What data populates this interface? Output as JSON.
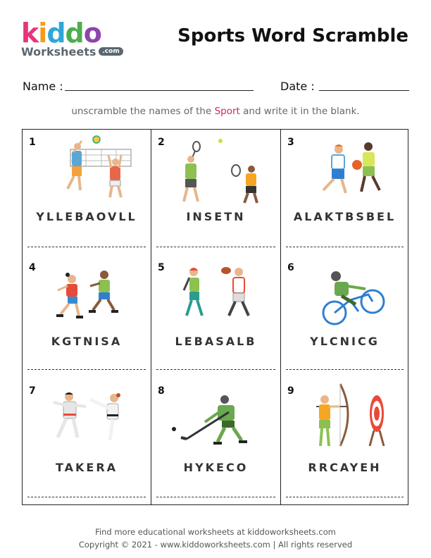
{
  "logo": {
    "letters": [
      {
        "ch": "k",
        "color": "#e8347a"
      },
      {
        "ch": "i",
        "color": "#f39c1b"
      },
      {
        "ch": "d",
        "color": "#2ea7d8"
      },
      {
        "ch": "d",
        "color": "#4cae4f"
      },
      {
        "ch": "o",
        "color": "#8e44ad"
      }
    ],
    "sub": "Worksheets",
    "com": ".com"
  },
  "title": "Sports Word Scramble",
  "name_label": "Name :",
  "date_label": "Date :",
  "instruction": {
    "before": "unscramble the names of the ",
    "highlight": "Sport",
    "after": " and write it in the blank."
  },
  "items": [
    {
      "num": "1",
      "word": "YLLEBAOVLL",
      "icon": "volleyball-players-icon"
    },
    {
      "num": "2",
      "word": "INSETN",
      "icon": "tennis-players-icon"
    },
    {
      "num": "3",
      "word": "ALAKTBSBEL",
      "icon": "basketball-players-icon"
    },
    {
      "num": "4",
      "word": "KGTNISA",
      "icon": "skating-kids-icon"
    },
    {
      "num": "5",
      "word": "LEBASALB",
      "icon": "baseball-players-icon"
    },
    {
      "num": "6",
      "word": "YLCNICG",
      "icon": "cyclist-icon"
    },
    {
      "num": "7",
      "word": "TAKERA",
      "icon": "karate-fighters-icon"
    },
    {
      "num": "8",
      "word": "HYKECO",
      "icon": "hockey-player-icon"
    },
    {
      "num": "9",
      "word": "RRCAYEH",
      "icon": "archer-target-icon"
    }
  ],
  "footer": {
    "line1": "Find more educational worksheets at kiddoworksheets.com",
    "line2": "Copyright © 2021 - www.kiddoworksheets.com  |  All rights reserved"
  }
}
